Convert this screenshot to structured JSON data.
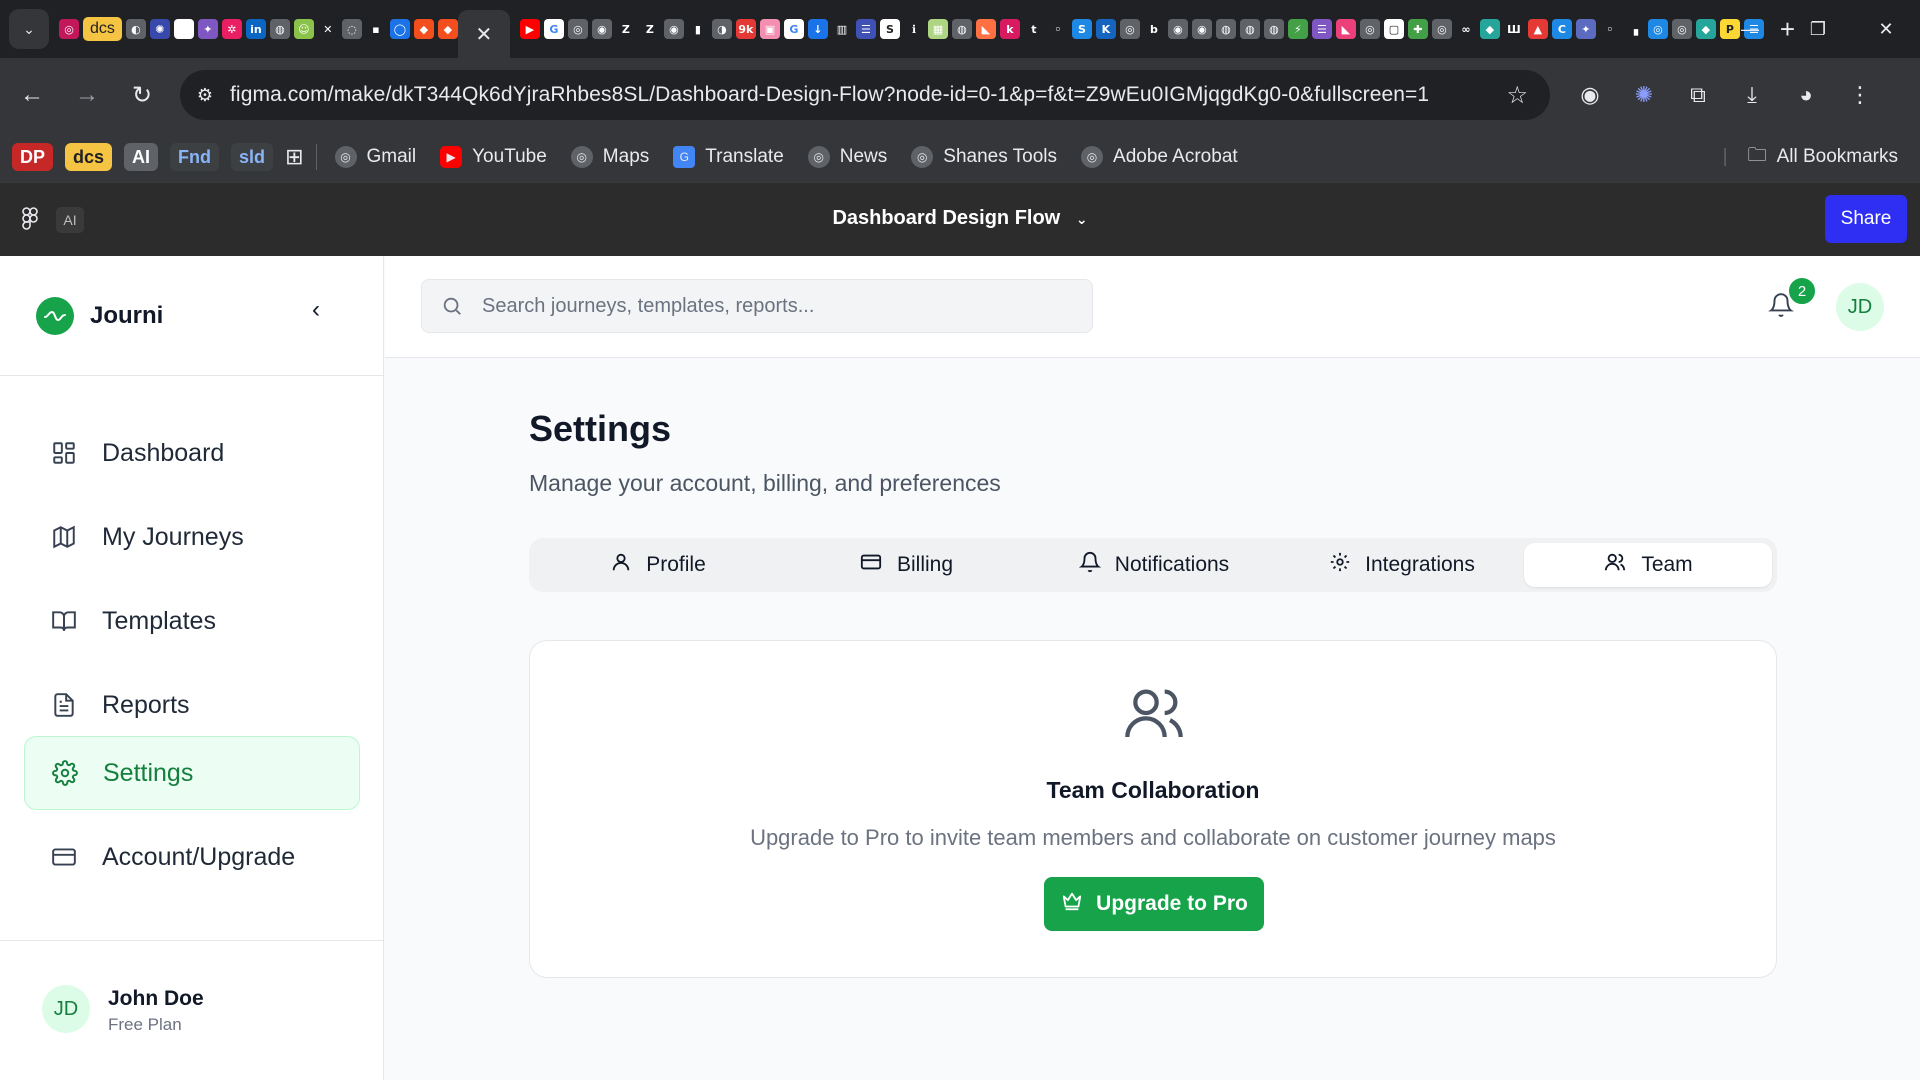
{
  "browser": {
    "pinned_tag": "dcs",
    "url": "figma.com/make/dkT344Qk6dYjraRhbes8SL/Dashboard-Design-Flow?node-id=0-1&p=f&t=Z9wEu0IGMjqgdKg0-0&fullscreen=1",
    "bookmark_tags": [
      "DP",
      "dcs",
      "AI",
      "Fnd",
      "sld"
    ],
    "bookmarks": [
      "Gmail",
      "YouTube",
      "Maps",
      "Translate",
      "News",
      "Shanes Tools",
      "Adobe Acrobat"
    ],
    "all_bookmarks": "All Bookmarks"
  },
  "figma": {
    "ai_chip": "AI",
    "file_title": "Dashboard Design Flow",
    "share": "Share"
  },
  "app": {
    "brand": "Journi",
    "nav": [
      {
        "label": "Dashboard",
        "icon": "grid-icon"
      },
      {
        "label": "My Journeys",
        "icon": "map-icon"
      },
      {
        "label": "Templates",
        "icon": "book-icon"
      },
      {
        "label": "Reports",
        "icon": "file-text-icon"
      },
      {
        "label": "Settings",
        "icon": "gear-icon",
        "active": true
      },
      {
        "label": "Account/Upgrade",
        "icon": "credit-card-icon"
      }
    ],
    "user": {
      "initials": "JD",
      "name": "John Doe",
      "plan": "Free Plan"
    },
    "search_placeholder": "Search journeys, templates, reports...",
    "notification_count": "2",
    "header_avatar": "JD"
  },
  "settings": {
    "title": "Settings",
    "subtitle": "Manage your account, billing, and preferences",
    "tabs": [
      "Profile",
      "Billing",
      "Notifications",
      "Integrations",
      "Team"
    ],
    "active_tab": "Team",
    "card": {
      "title": "Team Collaboration",
      "text": "Upgrade to Pro to invite team members and collaborate on customer journey maps",
      "button": "Upgrade to Pro"
    }
  },
  "colors": {
    "accent": "#16a34a",
    "share": "#2f2ff4"
  }
}
